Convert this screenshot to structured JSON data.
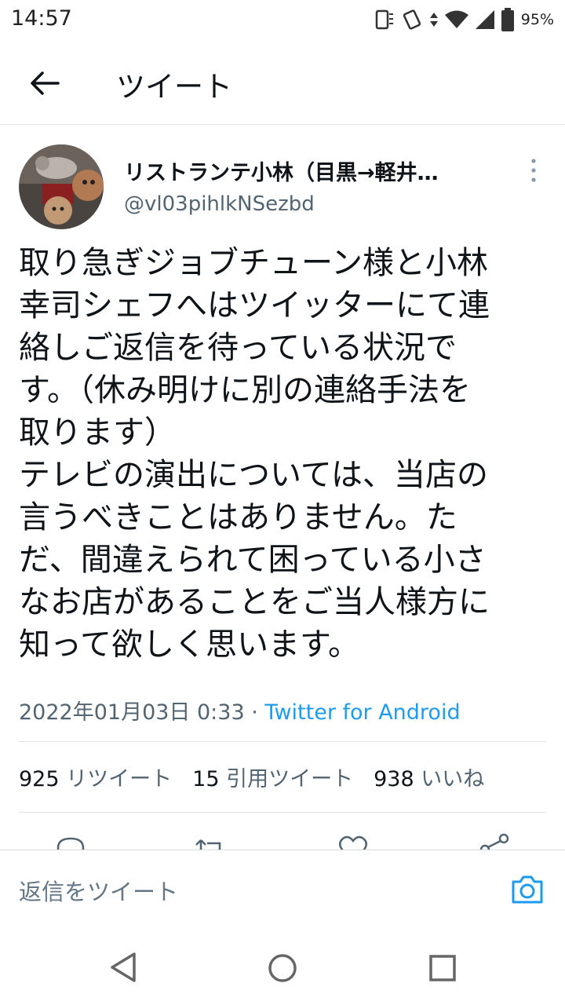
{
  "status_bar": {
    "time": "14:57",
    "battery": "95%"
  },
  "header": {
    "title": "ツイート"
  },
  "tweet": {
    "author_name": "リストランテ小林（目黒→軽井…",
    "author_handle": "@vl03pihlkNSezbd",
    "body": "取り急ぎジョブチューン様と小林\n幸司シェフへはツイッターにて連\n絡しご返信を待っている状況で\nす。（休み明けに別の連絡手法を\n取ります）\nテレビの演出については、当店の\n言うべきことはありません。た\nだ、間違えられて困っている小さ\nなお店があることをご当人様方に\n知って欲しく思います。",
    "timestamp": "2022年01月03日 0:33",
    "separator": "·",
    "source": "Twitter for Android",
    "stats": {
      "retweets_count": "925",
      "retweets_label": "リツイート",
      "quotes_count": "15",
      "quotes_label": "引用ツイート",
      "likes_count": "938",
      "likes_label": "いいね"
    }
  },
  "reply_bar": {
    "placeholder": "返信をツイート"
  },
  "colors": {
    "link": "#1d9bf0",
    "secondary_text": "#536471",
    "primary_text": "#0f1419"
  },
  "icons": [
    "back-arrow-icon",
    "more-vertical-icon",
    "reply-icon",
    "retweet-icon",
    "like-icon",
    "share-icon",
    "camera-icon",
    "nav-back-icon",
    "nav-home-icon",
    "nav-recents-icon"
  ]
}
